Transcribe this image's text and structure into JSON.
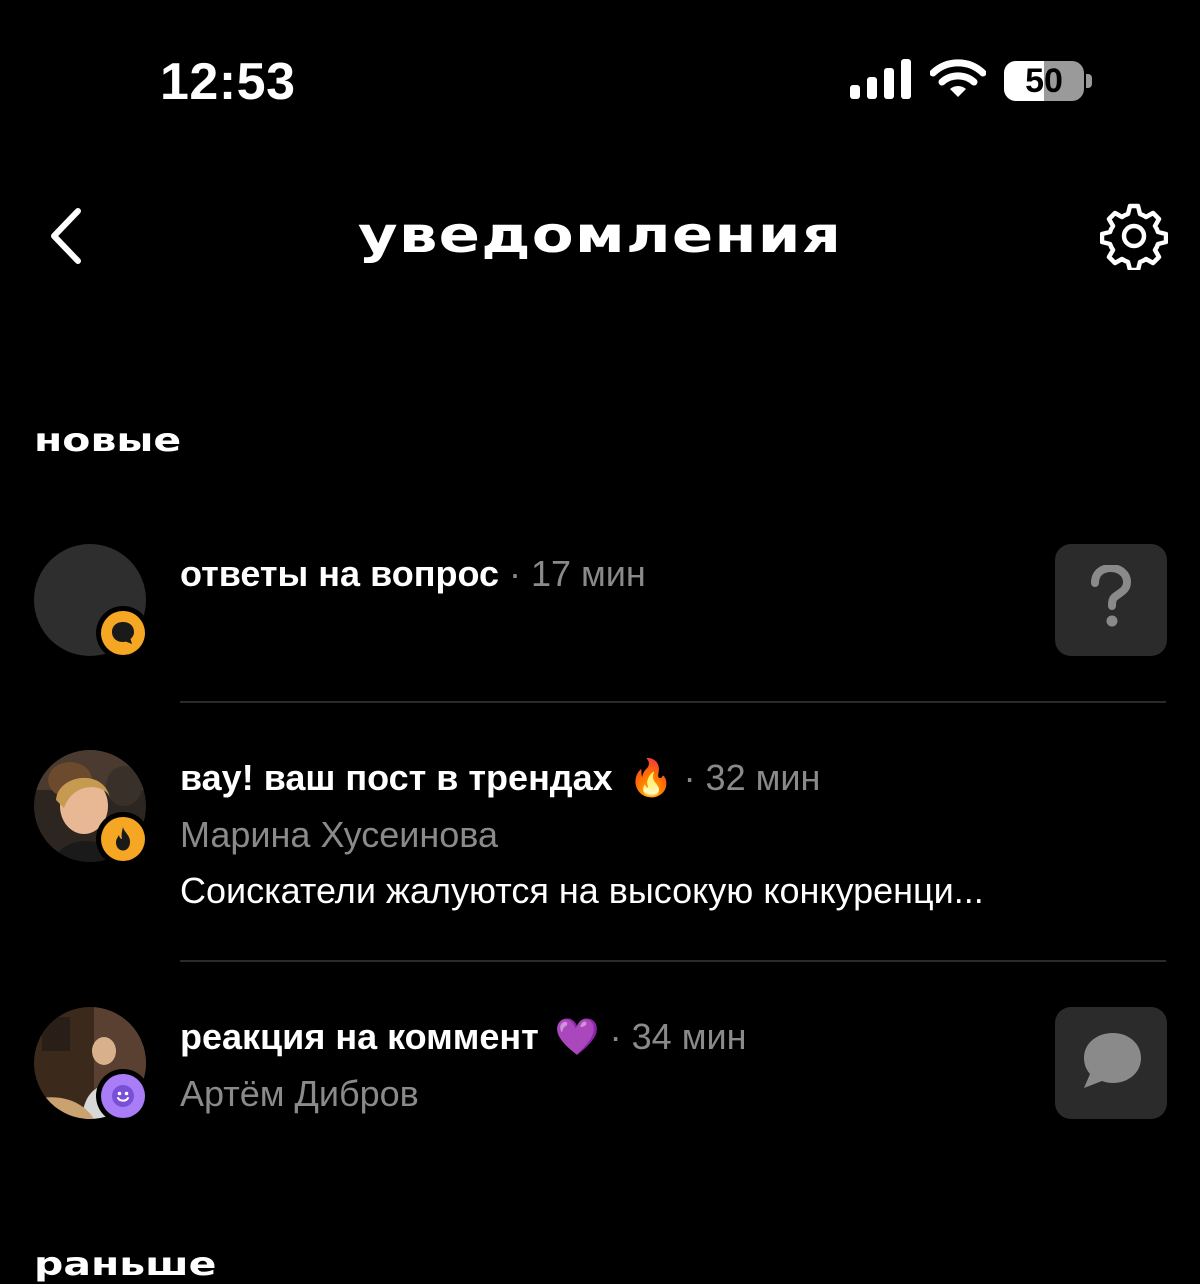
{
  "status_bar": {
    "time": "12:53",
    "battery_percent": "50",
    "battery_level": 0.5,
    "icons": [
      "cellular-signal-icon",
      "wifi-icon",
      "battery-icon"
    ]
  },
  "header": {
    "title": "уведомления",
    "back_icon": "chevron-left-icon",
    "settings_icon": "gear-icon"
  },
  "sections": {
    "new_label": "новые",
    "earlier_label": "раньше"
  },
  "notifications": [
    {
      "title": "ответы на вопрос",
      "time": "· 17 мин",
      "badge_icon": "speech-bubble-icon",
      "badge_color": "#F5A623",
      "thumbnail_icon": "question-mark-icon"
    },
    {
      "title": "вау! ваш пост в трендах",
      "emoji": "🔥",
      "time": "· 32 мин",
      "author": "Марина Хусеинова",
      "preview": "Соискатели жалуются на высокую конкуренци...",
      "badge_icon": "flame-icon",
      "badge_color": "#F5A623"
    },
    {
      "title": "реакция на коммент",
      "emoji": "💜",
      "time": "· 34 мин",
      "author": "Артём Дибров",
      "badge_icon": "smiley-icon",
      "badge_color": "#A97CF8",
      "thumbnail_icon": "comment-bubble-icon"
    }
  ],
  "colors": {
    "background": "#000000",
    "muted_text": "#8A8A8A",
    "divider": "#2A2A2A",
    "tile": "#2B2B2B",
    "orange_badge": "#F5A623",
    "purple_badge": "#A97CF8"
  }
}
